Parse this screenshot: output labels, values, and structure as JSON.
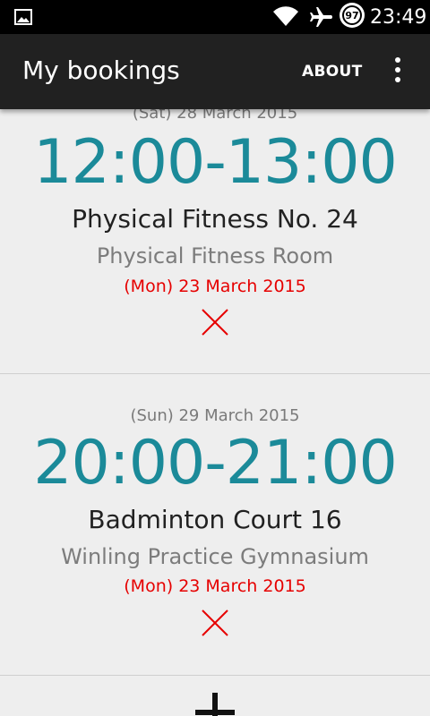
{
  "status_bar": {
    "time": "23:49",
    "battery_level": "97",
    "icons": [
      "image-notification-icon",
      "wifi-icon",
      "airplane-icon",
      "battery-icon"
    ]
  },
  "app_bar": {
    "title": "My bookings",
    "about_label": "ABOUT",
    "menu_icon": "overflow-menu-icon"
  },
  "bookings": [
    {
      "date": "(Sat) 28 March 2015",
      "time": "12:00-13:00",
      "activity": "Physical Fitness No. 24",
      "venue": "Physical Fitness Room",
      "booked_on": "(Mon) 23 March 2015"
    },
    {
      "date": "(Sun) 29 March 2015",
      "time": "20:00-21:00",
      "activity": "Badminton Court 16",
      "venue": "Winling Practice Gymnasium",
      "booked_on": "(Mon) 23 March 2015"
    }
  ],
  "colors": {
    "accent": "#1b8a99",
    "cancel": "#e60000",
    "app_bar": "#212121"
  }
}
